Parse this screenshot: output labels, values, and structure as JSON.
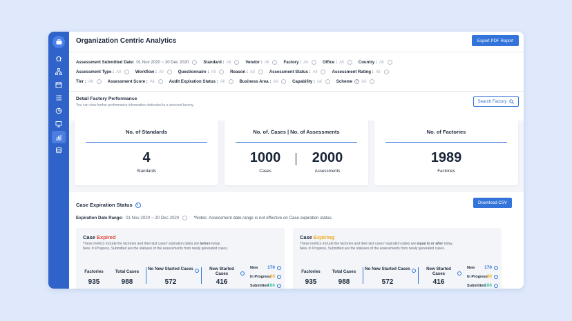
{
  "header": {
    "title": "Organization Centric Analytics",
    "export_label": "Export PDF Report"
  },
  "filters": {
    "row1": [
      {
        "label": "Assessment Submitted Date:",
        "value": "01 Nov 2020  ~  20 Dec 2020"
      },
      {
        "label": "Standard :",
        "value": "All"
      },
      {
        "label": "Vendor :",
        "value": "All"
      },
      {
        "label": "Factory :",
        "value": "All"
      },
      {
        "label": "Office :",
        "value": "All"
      },
      {
        "label": "Country :",
        "value": "All"
      }
    ],
    "row2": [
      {
        "label": "Assessment Type :",
        "value": "All"
      },
      {
        "label": "Workflow :",
        "value": "All"
      },
      {
        "label": "Questionnaire :",
        "value": "All"
      },
      {
        "label": "Reason :",
        "value": "All"
      },
      {
        "label": "Assessment Status :",
        "value": "All"
      },
      {
        "label": "Assessment Rating :",
        "value": "All"
      }
    ],
    "row3": [
      {
        "label": "Tier :",
        "value": "All"
      },
      {
        "label": "Assessment Score :",
        "value": "All"
      },
      {
        "label": "Audit Expiration Status :",
        "value": "All"
      },
      {
        "label": "Business Area :",
        "value": "All"
      },
      {
        "label": "Capability :",
        "value": "All"
      },
      {
        "label": "Scheme",
        "value": "All"
      }
    ]
  },
  "detail": {
    "title": "Detail Factory Performance",
    "subtitle": "You can view further performance information dedicated to a selected factory.",
    "search_label": "Search Factory"
  },
  "cards": {
    "standards": {
      "head": "No. of Standards",
      "value": "4",
      "label": "Standards"
    },
    "cases": {
      "head": "No. of. Cases  |  No. of Assessments",
      "cases_value": "1000",
      "cases_label": "Cases",
      "assess_value": "2000",
      "assess_label": "Assessments"
    },
    "factories": {
      "head": "No. of Factories",
      "value": "1989",
      "label": "Factories"
    }
  },
  "expiration": {
    "title": "Case Expiration Status",
    "download_label": "Download CSV",
    "range_label": "Expiration Date Range:",
    "range_value": "01 Nov 2020  ~  20 Dec 2020",
    "note": "*Notes: Assessment date range is not effective on Case expiration status."
  },
  "expired": {
    "title_prefix": "Case",
    "title_word": "Expired",
    "desc1_a": "These metrics include the factories and their last cases' expiration dates are",
    "desc1_b": "before",
    "desc1_c": "today.",
    "desc2": "New, In Progress, Submitted are the statuses of the assessments from newly generated cases.",
    "factories_label": "Factories",
    "factories_value": "935",
    "total_label": "Total Cases",
    "total_value": "988",
    "nonew_label": "No New Started Cases",
    "nonew_value": "572",
    "new_started_label": "New Started Cases",
    "new_started_value": "416",
    "new_label": "New",
    "new_value": "170",
    "progress_label": "In Progress",
    "progress_value": "60",
    "submitted_label": "Submitted",
    "submitted_value": "186"
  },
  "expiring": {
    "title_prefix": "Case",
    "title_word": "Expiring",
    "desc1_a": "These metrics include the factories and their last cases' expiration dates are",
    "desc1_b": "equal to or after",
    "desc1_c": "today.",
    "desc2": "New, In Progress, Submitted are the statuses of the assessments from newly generated cases.",
    "factories_label": "Factories",
    "factories_value": "935",
    "total_label": "Total Cases",
    "total_value": "988",
    "nonew_label": "No New Started Cases",
    "nonew_value": "572",
    "new_started_label": "New Started Cases",
    "new_started_value": "416",
    "new_label": "New",
    "new_value": "170",
    "progress_label": "In Progress",
    "progress_value": "60",
    "submitted_label": "Submitted",
    "submitted_value": "186"
  },
  "colors": {
    "accent": "#3274d9",
    "expired": "#e0413a",
    "expiring": "#f0a81c",
    "progress": "#f0a81c",
    "submitted": "#3fc4a2"
  },
  "sidebar": {
    "icons": [
      "briefcase-icon",
      "home-icon",
      "org-chart-icon",
      "calendar-icon",
      "list-icon",
      "pie-chart-icon",
      "monitor-icon",
      "bar-chart-icon",
      "database-icon"
    ]
  }
}
